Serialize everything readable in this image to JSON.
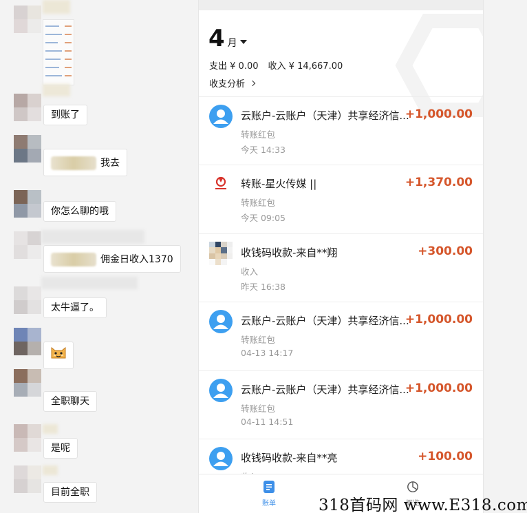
{
  "chat": {
    "messages": [
      {
        "text": "到账了"
      },
      {
        "text": "我去"
      },
      {
        "text": "你怎么聊的哦"
      },
      {
        "text": "佣金日收入1370"
      },
      {
        "text": "太牛逼了。"
      },
      {
        "text": "[sticker]",
        "sticker": "cat-face-emoji"
      },
      {
        "text": "全职聊天"
      },
      {
        "text": "是呢"
      },
      {
        "text": "目前全职"
      }
    ]
  },
  "bill": {
    "month_num": "4",
    "month_unit": "月",
    "expense_label": "支出",
    "expense_value": "¥ 0.00",
    "income_label": "收入",
    "income_value": "¥ 14,667.00",
    "analysis_label": "收支分析",
    "rows": [
      {
        "title": "云账户-云账户（天津）共享经济信...",
        "amount": "+1,000.00",
        "type": "转账红包",
        "time": "今天  14:33",
        "icon": "user-avatar-icon"
      },
      {
        "title": "转账-星火传媒 ||",
        "amount": "+1,370.00",
        "type": "转账红包",
        "time": "今天  09:05",
        "icon": "xinghuo-logo-icon"
      },
      {
        "title": "收钱码收款-来自**翔",
        "amount": "+300.00",
        "type": "收入",
        "time": "昨天  16:38",
        "icon": "mosaic-avatar-icon"
      },
      {
        "title": "云账户-云账户（天津）共享经济信...",
        "amount": "+1,000.00",
        "type": "转账红包",
        "time": "04-13  14:17",
        "icon": "user-avatar-icon"
      },
      {
        "title": "云账户-云账户（天津）共享经济信...",
        "amount": "+1,000.00",
        "type": "转账红包",
        "time": "04-11  14:51",
        "icon": "user-avatar-icon"
      },
      {
        "title": "收钱码收款-来自**亮",
        "amount": "+100.00",
        "type": "收入",
        "time": "",
        "icon": "user-avatar-icon"
      }
    ],
    "tabs": [
      {
        "label": "账单",
        "active": true
      },
      {
        "label": "概览",
        "active": false
      }
    ],
    "colors": {
      "accent": "#3d8fe8",
      "amount": "#d5562b"
    }
  },
  "watermark": "318首码网 www.E318.com"
}
